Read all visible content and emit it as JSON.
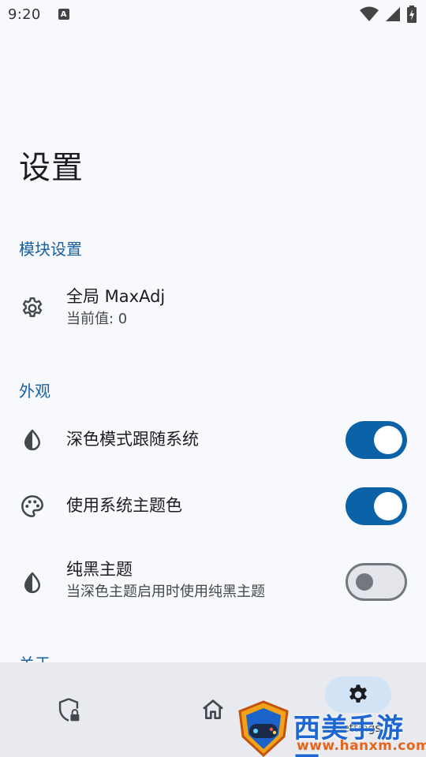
{
  "status_bar": {
    "time": "9:20",
    "notification_letter": "A"
  },
  "page": {
    "title": "设置"
  },
  "sections": {
    "module": {
      "title": "模块设置"
    },
    "appearance": {
      "title": "外观"
    },
    "about": {
      "title": "关于"
    }
  },
  "module_items": [
    {
      "title": "全局 MaxAdj",
      "subtitle": "当前值: 0",
      "icon": "gear-icon"
    }
  ],
  "appearance_items": [
    {
      "title": "深色模式跟随系统",
      "icon": "contrast-icon",
      "enabled": true
    },
    {
      "title": "使用系统主题色",
      "icon": "palette-icon",
      "enabled": true
    },
    {
      "title": "纯黑主题",
      "subtitle": "当深色主题启用时使用纯黑主题",
      "icon": "contrast-icon",
      "enabled": false
    }
  ],
  "bottom_nav": {
    "items": [
      {
        "icon": "shield-lock-icon"
      },
      {
        "icon": "home-icon"
      },
      {
        "icon": "gear-icon",
        "label": "Settings",
        "active": true
      }
    ]
  },
  "watermark": {
    "text": "西美手游网",
    "url": "www.hanxm.com"
  },
  "colors": {
    "accent": "#0b62a6",
    "section": "#1a5fa0",
    "background": "#f8f9fc",
    "nav_bg": "#e8eaef"
  }
}
